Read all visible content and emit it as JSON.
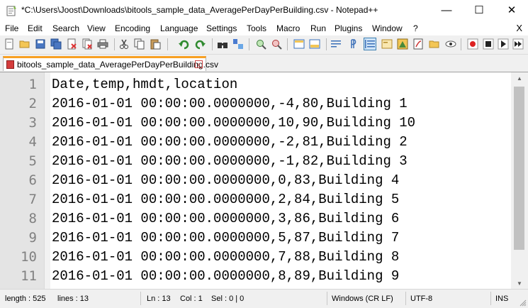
{
  "window": {
    "title": "*C:\\Users\\Joost\\Downloads\\bitools_sample_data_AveragePerDayPerBuilding.csv - Notepad++",
    "minimize_glyph": "—",
    "maximize_glyph": "☐",
    "close_glyph": "✕"
  },
  "menu": {
    "items": [
      "File",
      "Edit",
      "Search",
      "View",
      "Encoding",
      "Language",
      "Settings",
      "Tools",
      "Macro",
      "Run",
      "Plugins",
      "Window",
      "?"
    ],
    "close_glyph": "X"
  },
  "toolbar": {
    "icons": [
      "new-file-icon",
      "open-file-icon",
      "save-icon",
      "save-all-icon",
      "close-icon",
      "close-all-icon",
      "print-icon",
      "cut-icon",
      "copy-icon",
      "paste-icon",
      "undo-icon",
      "redo-icon",
      "find-icon",
      "replace-icon",
      "zoom-in-icon",
      "zoom-out-icon",
      "sync-vertical-icon",
      "sync-horizontal-icon",
      "word-wrap-icon",
      "show-all-chars-icon",
      "indent-guide-icon",
      "user-defined-language-icon",
      "document-map-icon",
      "function-list-icon",
      "folder-as-workspace-icon",
      "monitoring-icon",
      "record-macro-icon",
      "stop-record-icon",
      "play-macro-icon",
      "run-macro-multiple-icon",
      "save-macro-icon"
    ],
    "active_icon": "indent-guide-icon"
  },
  "tab": {
    "label": "bitools_sample_data_AveragePerDayPerBuilding.csv",
    "close_glyph": "x"
  },
  "editor": {
    "lines": [
      {
        "number": "1",
        "text": "Date,temp,hmdt,location"
      },
      {
        "number": "2",
        "text": "2016-01-01 00:00:00.0000000,-4,80,Building 1"
      },
      {
        "number": "3",
        "text": "2016-01-01 00:00:00.0000000,10,90,Building 10"
      },
      {
        "number": "4",
        "text": "2016-01-01 00:00:00.0000000,-2,81,Building 2"
      },
      {
        "number": "5",
        "text": "2016-01-01 00:00:00.0000000,-1,82,Building 3"
      },
      {
        "number": "6",
        "text": "2016-01-01 00:00:00.0000000,0,83,Building 4"
      },
      {
        "number": "7",
        "text": "2016-01-01 00:00:00.0000000,2,84,Building 5"
      },
      {
        "number": "8",
        "text": "2016-01-01 00:00:00.0000000,3,86,Building 6"
      },
      {
        "number": "9",
        "text": "2016-01-01 00:00:00.0000000,5,87,Building 7"
      },
      {
        "number": "10",
        "text": "2016-01-01 00:00:00.0000000,7,88,Building 8"
      },
      {
        "number": "11",
        "text": "2016-01-01 00:00:00.0000000,8,89,Building 9"
      }
    ]
  },
  "status": {
    "length": "length : 525",
    "lines": "lines : 13",
    "ln": "Ln : 13",
    "col": "Col : 1",
    "sel": "Sel : 0 | 0",
    "eol": "Windows (CR LF)",
    "encoding": "UTF-8",
    "mode": "INS"
  }
}
